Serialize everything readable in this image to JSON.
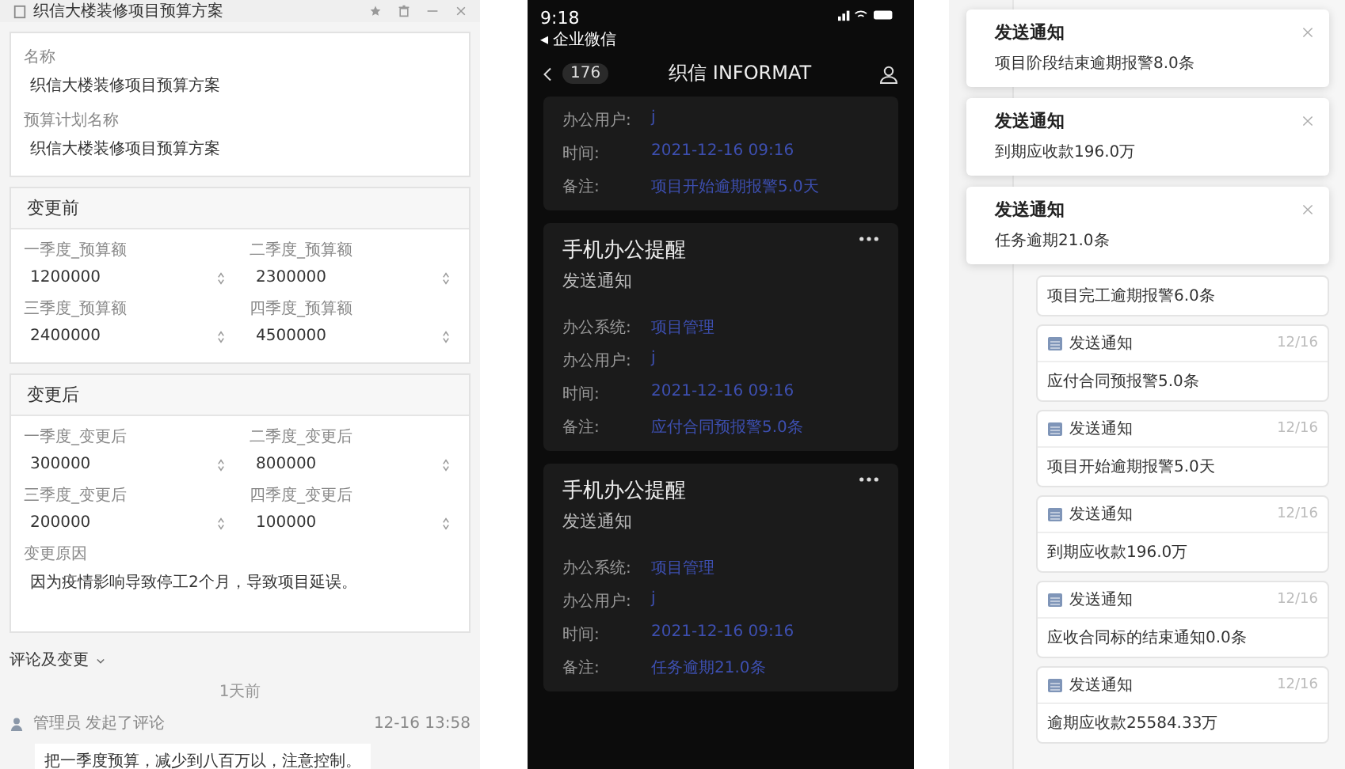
{
  "form": {
    "title": "织信大楼装修项目预算方案",
    "fields": [
      {
        "label": "名称",
        "value": "织信大楼装修项目预算方案"
      },
      {
        "label": "预算计划名称",
        "value": "织信大楼装修项目预算方案"
      }
    ],
    "sections": [
      {
        "title": "变更前",
        "fields": [
          {
            "kind": "number",
            "label": "一季度_预算额",
            "value": "1200000"
          },
          {
            "kind": "number",
            "label": "二季度_预算额",
            "value": "2300000"
          },
          {
            "kind": "number",
            "label": "三季度_预算额",
            "value": "2400000"
          },
          {
            "kind": "number",
            "label": "四季度_预算额",
            "value": "4500000"
          }
        ]
      },
      {
        "title": "变更后",
        "fields": [
          {
            "kind": "number",
            "label": "一季度_变更后",
            "value": "300000"
          },
          {
            "kind": "number",
            "label": "二季度_变更后",
            "value": "800000"
          },
          {
            "kind": "number",
            "label": "三季度_变更后",
            "value": "200000"
          },
          {
            "kind": "number",
            "label": "四季度_变更后",
            "value": "100000"
          },
          {
            "kind": "text",
            "label": "变更原因",
            "value": "因为疫情影响导致停工2个月，导致项目延误。"
          }
        ]
      }
    ],
    "comments": {
      "title": "评论及变更",
      "divider": "1天前",
      "entries": [
        {
          "author": "管理员 发起了评论",
          "time": "12-16 13:58",
          "text": "把一季度预算，减少到八百万以，注意控制。"
        }
      ]
    }
  },
  "phone": {
    "time": "9:18",
    "back_app": "◂ 企业微信",
    "count": "176",
    "title": "织信 INFORMAT",
    "cards": [
      {
        "rows": [
          {
            "label": "办公用户:",
            "value": "j"
          },
          {
            "label": "时间:",
            "value": "2021-12-16 09:16"
          },
          {
            "label": "备注:",
            "value": "项目开始逾期报警5.0天"
          }
        ]
      },
      {
        "title": "手机办公提醒",
        "subtitle": "发送通知",
        "rows": [
          {
            "label": "办公系统:",
            "value": "项目管理"
          },
          {
            "label": "办公用户:",
            "value": "j"
          },
          {
            "label": "时间:",
            "value": "2021-12-16 09:16"
          },
          {
            "label": "备注:",
            "value": "应付合同预报警5.0条"
          }
        ]
      },
      {
        "title": "手机办公提醒",
        "subtitle": "发送通知",
        "rows": [
          {
            "label": "办公系统:",
            "value": "项目管理"
          },
          {
            "label": "办公用户:",
            "value": "j"
          },
          {
            "label": "时间:",
            "value": "2021-12-16 09:16"
          },
          {
            "label": "备注:",
            "value": "任务逾期21.0条"
          }
        ]
      }
    ]
  },
  "notifications": {
    "toasts": [
      {
        "title": "发送通知",
        "text": "项目阶段结束逾期报警8.0条"
      },
      {
        "title": "发送通知",
        "text": "到期应收款196.0万"
      },
      {
        "title": "发送通知",
        "text": "任务逾期21.0条"
      }
    ],
    "items": [
      {
        "text": "项目完工逾期报警6.0条"
      },
      {
        "title": "发送通知",
        "date": "12/16",
        "text": "应付合同预报警5.0条"
      },
      {
        "title": "发送通知",
        "date": "12/16",
        "text": "项目开始逾期报警5.0天"
      },
      {
        "title": "发送通知",
        "date": "12/16",
        "text": "到期应收款196.0万"
      },
      {
        "title": "发送通知",
        "date": "12/16",
        "text": "应收合同标的结束通知0.0条"
      },
      {
        "title": "发送通知",
        "date": "12/16",
        "text": "逾期应收款25584.33万"
      }
    ]
  }
}
